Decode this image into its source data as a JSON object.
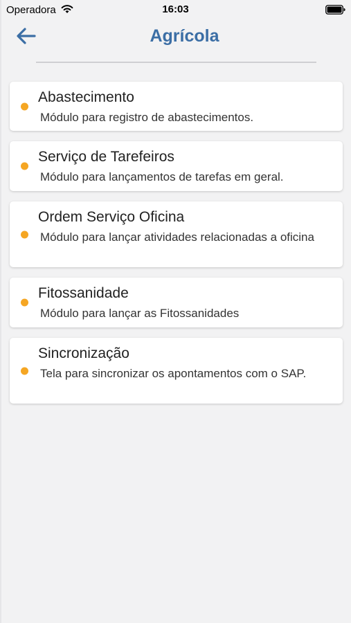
{
  "status_bar": {
    "carrier": "Operadora",
    "time": "16:03"
  },
  "header": {
    "title": "Agrícola",
    "back_icon": "arrow-left-icon"
  },
  "colors": {
    "accent": "#3b6ea5",
    "bullet": "#f5a623",
    "background": "#f2f2f3",
    "card": "#ffffff"
  },
  "menu": {
    "items": [
      {
        "title": "Abastecimento",
        "description": "Módulo para registro de abastecimentos."
      },
      {
        "title": "Serviço de Tarefeiros",
        "description": "Módulo para lançamentos de tarefas em geral."
      },
      {
        "title": "Ordem Serviço Oficina",
        "description": "Módulo para lançar atividades relacionadas a oficina"
      },
      {
        "title": "Fitossanidade",
        "description": "Módulo para lançar as Fitossanidades"
      },
      {
        "title": "Sincronização",
        "description": "Tela para sincronizar os apontamentos com o SAP."
      }
    ]
  }
}
